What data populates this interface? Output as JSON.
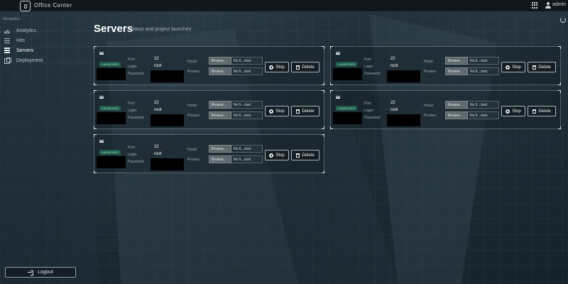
{
  "app": {
    "title": "Office Center",
    "user": "admin"
  },
  "sidebar": {
    "heading": "Navigation",
    "items": [
      {
        "label": "Analytics",
        "icon": "analytics-icon",
        "active": false
      },
      {
        "label": "Hits",
        "icon": "list-icon",
        "active": false
      },
      {
        "label": "Servers",
        "icon": "server-icon",
        "active": true
      },
      {
        "label": "Deployment",
        "icon": "deployment-icon",
        "active": false
      }
    ],
    "logout_label": "Logout"
  },
  "page": {
    "title": "Servers",
    "subtitle": "status and project launches"
  },
  "labels": {
    "port": "Port:",
    "login": "Login:",
    "password": "Password:",
    "hosts": "Hosts:",
    "proxies": "Proxies:",
    "browse": "Browse...",
    "no_file": "No fi...cted.",
    "stop": "Stop",
    "delete": "Delete"
  },
  "servers": [
    {
      "status": "LAUNCHED",
      "port": "22",
      "login": "root"
    },
    {
      "status": "LAUNCHED",
      "port": "22",
      "login": "root"
    },
    {
      "status": "LAUNCHED",
      "port": "22",
      "login": "root"
    },
    {
      "status": "LAUNCHED",
      "port": "22",
      "login": "root"
    },
    {
      "status": "LAUNCHED",
      "port": "22",
      "login": "root"
    }
  ],
  "colors": {
    "badge": "#1f5c4a",
    "background": "#1c2a33",
    "topbar": "#10181e"
  }
}
